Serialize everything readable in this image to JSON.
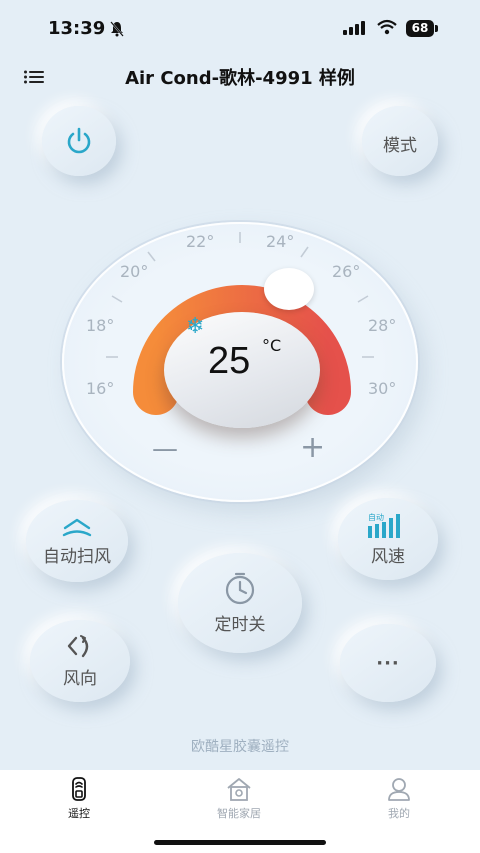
{
  "status": {
    "time": "13:39",
    "battery": "68"
  },
  "header": {
    "title": "Air Cond-歌林-4991 样例"
  },
  "controls": {
    "power_icon": "power-icon",
    "mode_label": "模式",
    "sweep_label": "自动扫风",
    "speed_label": "风速",
    "speed_badge": "自动",
    "timer_label": "定时关",
    "direction_label": "风向",
    "more_label": "···"
  },
  "dial": {
    "temperature": "25",
    "unit": "°C",
    "minus": "—",
    "plus": "+",
    "mode_icon": "snowflake-icon",
    "ticks": [
      "16°",
      "18°",
      "20°",
      "22°",
      "24°",
      "26°",
      "28°",
      "30°"
    ],
    "range": [
      16,
      30
    ],
    "current": 25
  },
  "footer": {
    "brand": "欧酷星胶囊遥控"
  },
  "tabs": [
    {
      "label": "遥控",
      "icon": "remote-icon",
      "active": true
    },
    {
      "label": "智能家居",
      "icon": "home-icon",
      "active": false
    },
    {
      "label": "我的",
      "icon": "user-icon",
      "active": false
    }
  ],
  "colors": {
    "accent": "#2aa7c9",
    "arc_start": "#f58c3a",
    "arc_end": "#e5514b",
    "inactive": "#a0a8b2"
  }
}
